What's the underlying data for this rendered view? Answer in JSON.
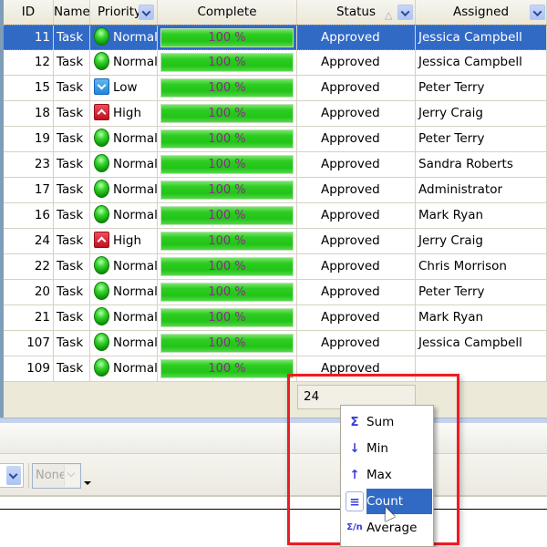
{
  "grid": {
    "columns": [
      {
        "key": "id",
        "label": "ID"
      },
      {
        "key": "name",
        "label": "Name"
      },
      {
        "key": "priority",
        "label": "Priority",
        "filter_icon": "filter-dropdown-icon"
      },
      {
        "key": "complete",
        "label": "Complete"
      },
      {
        "key": "status",
        "label": "Status",
        "sort_icon": "sort-ascending-icon",
        "filter_icon": "filter-dropdown-icon"
      },
      {
        "key": "assigned",
        "label": "Assigned",
        "filter_icon": "filter-dropdown-icon"
      }
    ],
    "rows": [
      {
        "id": "11",
        "name": "Task",
        "priority": "Normal",
        "complete": 100,
        "complete_label": "100 %",
        "status": "Approved",
        "assigned": "Jessica Campbell",
        "selected": true
      },
      {
        "id": "12",
        "name": "Task",
        "priority": "Normal",
        "complete": 100,
        "complete_label": "100 %",
        "status": "Approved",
        "assigned": "Jessica Campbell"
      },
      {
        "id": "15",
        "name": "Task",
        "priority": "Low",
        "complete": 100,
        "complete_label": "100 %",
        "status": "Approved",
        "assigned": "Peter Terry"
      },
      {
        "id": "18",
        "name": "Task",
        "priority": "High",
        "complete": 100,
        "complete_label": "100 %",
        "status": "Approved",
        "assigned": "Jerry Craig"
      },
      {
        "id": "19",
        "name": "Task",
        "priority": "Normal",
        "complete": 100,
        "complete_label": "100 %",
        "status": "Approved",
        "assigned": "Peter Terry"
      },
      {
        "id": "23",
        "name": "Task",
        "priority": "Normal",
        "complete": 100,
        "complete_label": "100 %",
        "status": "Approved",
        "assigned": "Sandra Roberts"
      },
      {
        "id": "17",
        "name": "Task",
        "priority": "Normal",
        "complete": 100,
        "complete_label": "100 %",
        "status": "Approved",
        "assigned": "Administrator"
      },
      {
        "id": "16",
        "name": "Task",
        "priority": "Normal",
        "complete": 100,
        "complete_label": "100 %",
        "status": "Approved",
        "assigned": "Mark Ryan"
      },
      {
        "id": "24",
        "name": "Task",
        "priority": "High",
        "complete": 100,
        "complete_label": "100 %",
        "status": "Approved",
        "assigned": "Jerry Craig"
      },
      {
        "id": "22",
        "name": "Task",
        "priority": "Normal",
        "complete": 100,
        "complete_label": "100 %",
        "status": "Approved",
        "assigned": "Chris Morrison"
      },
      {
        "id": "20",
        "name": "Task",
        "priority": "Normal",
        "complete": 100,
        "complete_label": "100 %",
        "status": "Approved",
        "assigned": "Peter Terry"
      },
      {
        "id": "21",
        "name": "Task",
        "priority": "Normal",
        "complete": 100,
        "complete_label": "100 %",
        "status": "Approved",
        "assigned": "Mark Ryan"
      },
      {
        "id": "107",
        "name": "Task",
        "priority": "Normal",
        "complete": 100,
        "complete_label": "100 %",
        "status": "Approved",
        "assigned": "Jessica Campbell"
      },
      {
        "id": "109",
        "name": "Task",
        "priority": "Normal",
        "complete": 100,
        "complete_label": "100 %",
        "status": "Approved",
        "assigned": ""
      }
    ],
    "footer_summary": "24"
  },
  "summary_menu": {
    "items": [
      {
        "label": "Sum",
        "icon": "sum-icon",
        "glyph": "Σ"
      },
      {
        "label": "Min",
        "icon": "min-icon",
        "glyph": "↓"
      },
      {
        "label": "Max",
        "icon": "max-icon",
        "glyph": "↑"
      },
      {
        "label": "Count",
        "icon": "count-icon",
        "glyph": "≡",
        "active": true
      },
      {
        "label": "Average",
        "icon": "average-icon",
        "glyph": "Σ/n"
      }
    ]
  },
  "toolbar": {
    "combo_value": "None"
  },
  "colors": {
    "selection": "#316ac5",
    "progress": "#2ccd20",
    "progress_text": "#8a2a8a",
    "highlight_box": "#ee1c24"
  }
}
